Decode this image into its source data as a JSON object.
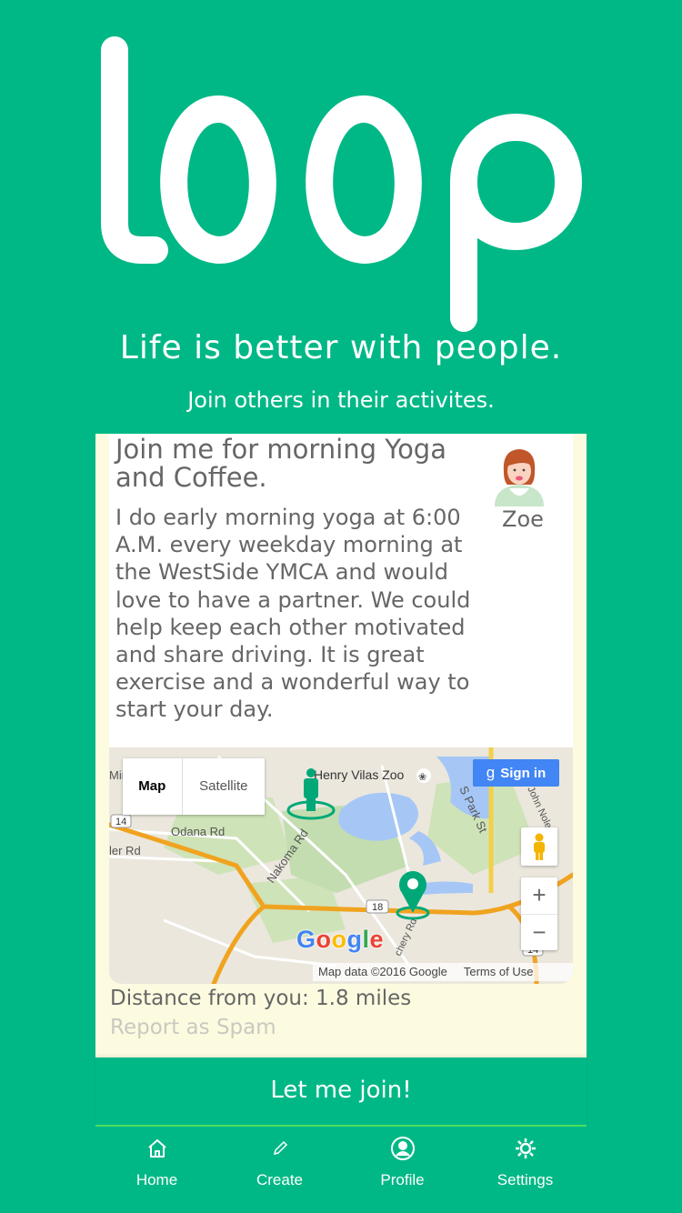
{
  "brand": {
    "logo_text": "loop",
    "accent": "#00b886"
  },
  "header": {
    "tagline": "Life is better with people.",
    "subtagline": "Join others in their activites."
  },
  "post": {
    "title": "Join me for morning Yoga and Coffee.",
    "body": "I do early morning yoga at 6:00 A.M. every weekday morning at the WestSide YMCA and would love to have a partner. We could help keep each other motivated and share driving. It is great exercise and a wonderful way to start your day.",
    "author": "Zoe",
    "distance": "Distance from you: 1.8 miles",
    "spam_label": "Report as Spam"
  },
  "map": {
    "toggle_map": "Map",
    "toggle_satellite": "Satellite",
    "signin": "Sign in",
    "zoom_in": "+",
    "zoom_out": "−",
    "attribution": "Map data ©2016 Google",
    "terms": "Terms of Use",
    "labels": {
      "zoo": "Henry Vilas Zoo",
      "odana": "Odana Rd",
      "ler": "ler Rd",
      "nakoma": "Nakoma Rd",
      "spark": "S Park St",
      "john_nolen": "John Nolen",
      "hwy14": "14",
      "hwy18": "18",
      "hwy14b": "14",
      "fish": "chery Rd",
      "min": "Min"
    }
  },
  "join_button": "Let me join!",
  "tabbar": [
    {
      "label": "Home",
      "icon": "home-icon"
    },
    {
      "label": "Create",
      "icon": "pencil-icon"
    },
    {
      "label": "Profile",
      "icon": "profile-icon"
    },
    {
      "label": "Settings",
      "icon": "gear-icon"
    }
  ]
}
